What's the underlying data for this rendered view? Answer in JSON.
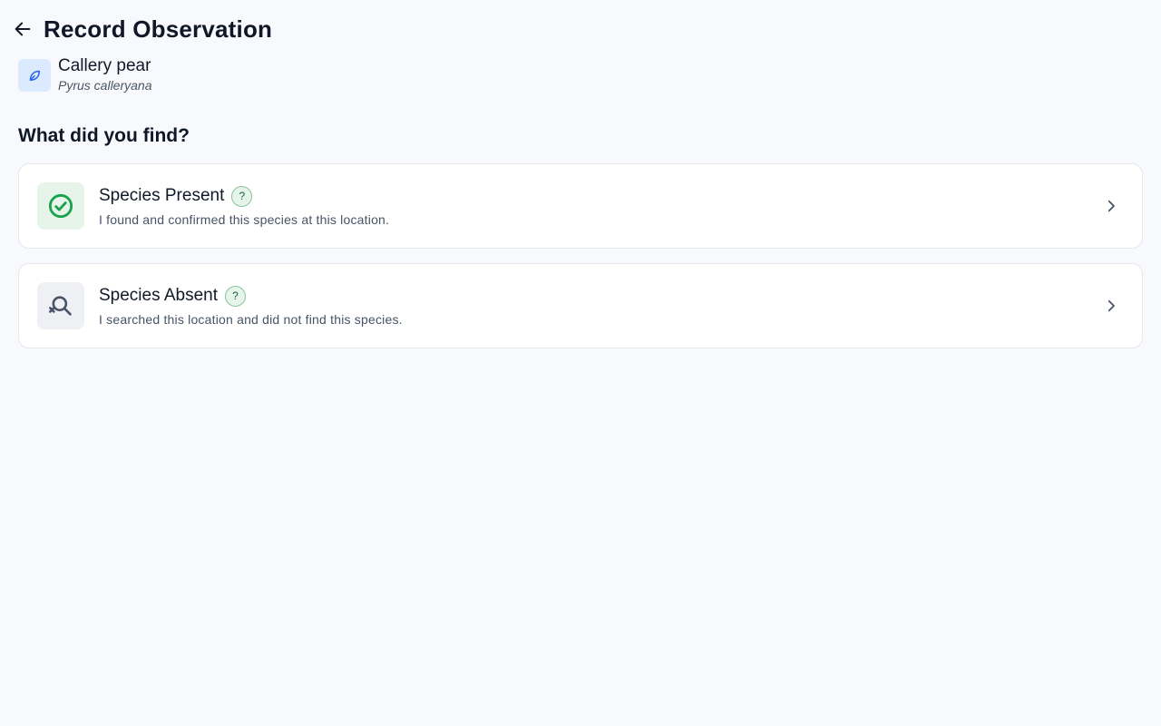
{
  "header": {
    "title": "Record Observation",
    "back_icon": "arrow-left-icon"
  },
  "species": {
    "common_name": "Callery pear",
    "scientific_name": "Pyrus calleryana",
    "icon": "leaf-icon",
    "icon_color": "#2563eb"
  },
  "question": "What did you find?",
  "options": [
    {
      "title": "Species Present",
      "description": "I found and confirmed this species at this location.",
      "help": "?",
      "icon": "check-circle-icon",
      "icon_color": "#16a34a"
    },
    {
      "title": "Species Absent",
      "description": "I searched this location and did not find this species.",
      "help": "?",
      "icon": "search-x-icon",
      "icon_color": "#667085"
    }
  ]
}
